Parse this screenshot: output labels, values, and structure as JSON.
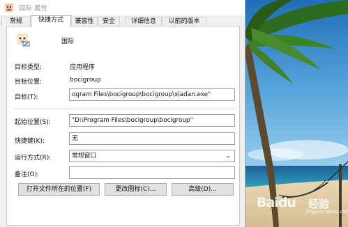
{
  "window": {
    "title": "国际 属性"
  },
  "tabs": [
    "常规",
    "快捷方式",
    "兼容性",
    "安全",
    "详细信息",
    "以前的版本"
  ],
  "active_tab": "快捷方式",
  "shortcut": {
    "name": "国际",
    "target_type_label": "目标类型:",
    "target_type_value": "应用程序",
    "target_location_label": "目标位置:",
    "target_location_value": "bocigroup",
    "target_label": "目标(T):",
    "target_value": "ogram Files\\bocigroup\\bocigroup\\xiadan.exe\"",
    "start_in_label": "起始位置(S):",
    "start_in_value": "\"D:\\Program Files\\bocigroup\\bocigroup\"",
    "hotkey_label": "快捷键(K):",
    "hotkey_value": "无",
    "run_label": "运行方式(R):",
    "run_value": "常规窗口",
    "comment_label": "备注(O):",
    "comment_value": ""
  },
  "buttons": {
    "open_location": "打开文件所在的位置(F)",
    "change_icon": "更改图标(C)...",
    "advanced": "高级(D)..."
  },
  "watermark": {
    "logo": "Baidu",
    "text": "经验",
    "sub": "jingyan.baidu.com"
  }
}
